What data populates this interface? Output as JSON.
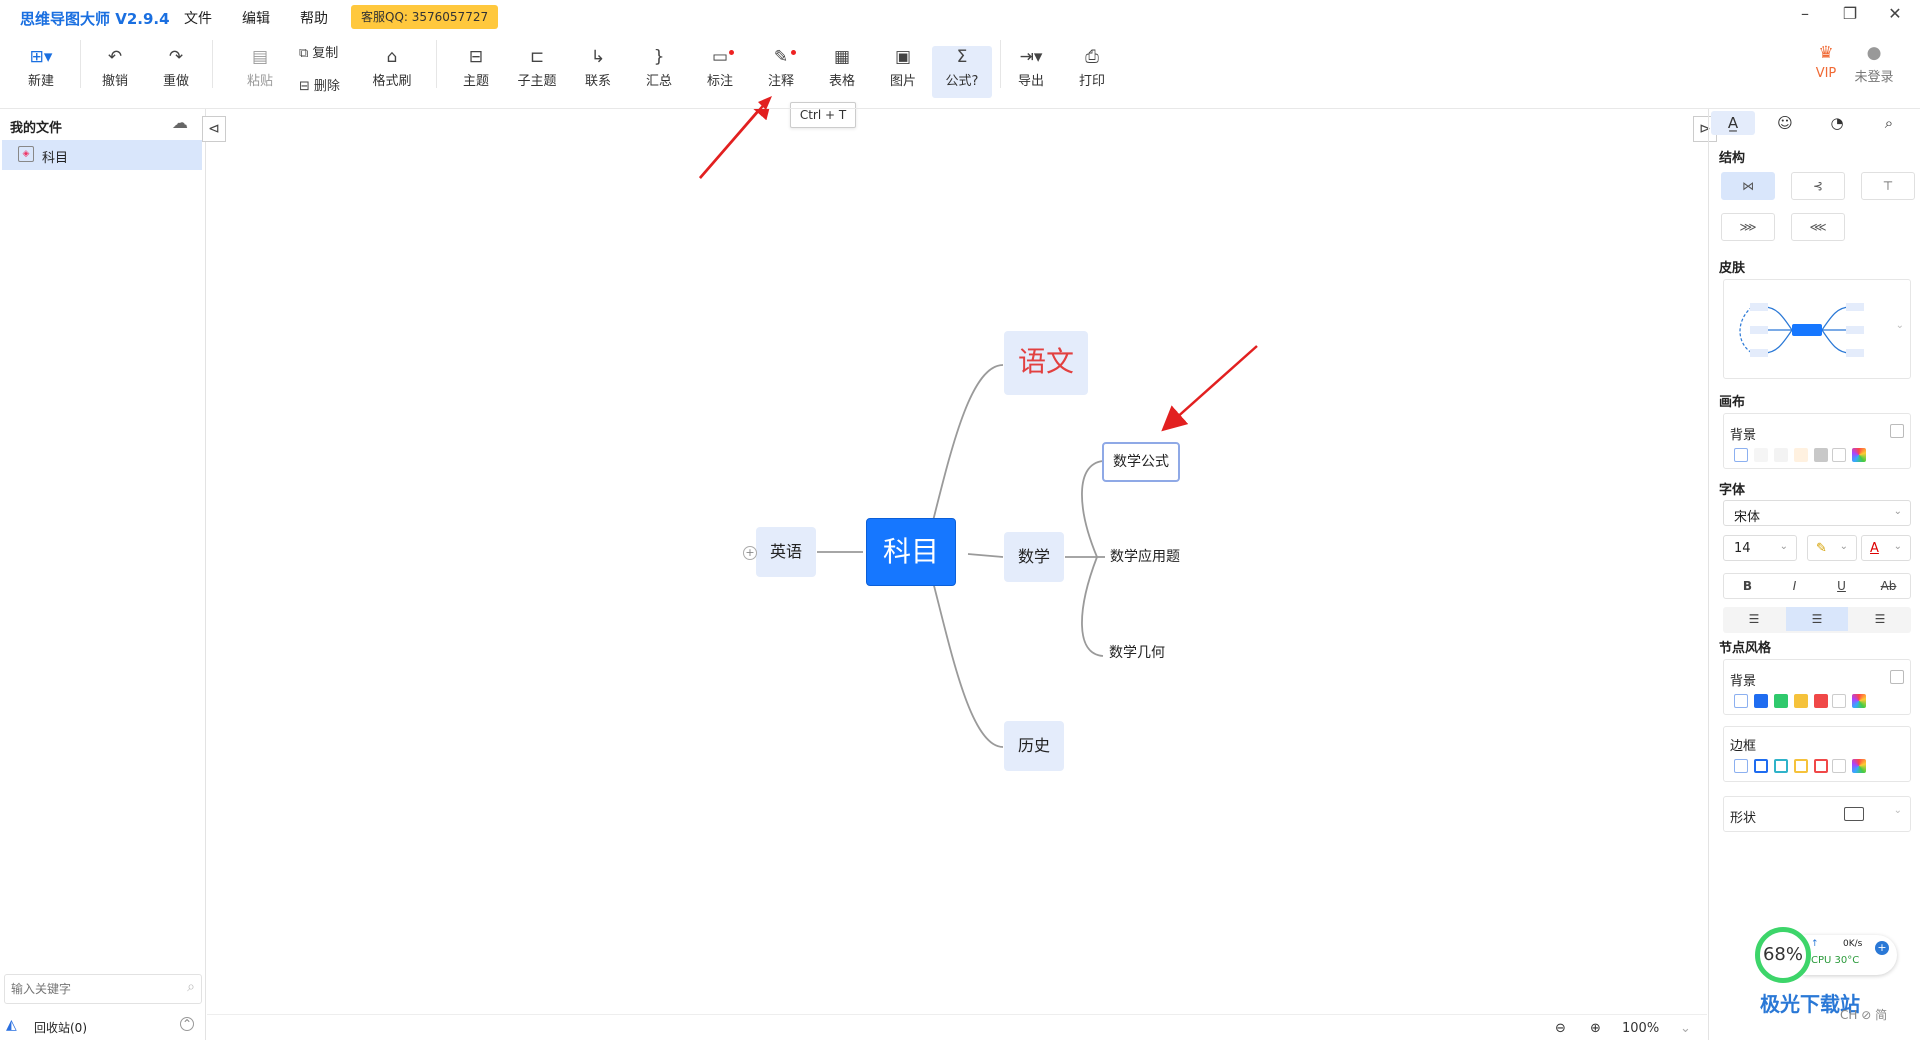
{
  "app": {
    "title": "思维导图大师 V2.9.4",
    "menu": [
      "文件",
      "编辑",
      "帮助"
    ],
    "support_badge": "客服QQ: 3576057727",
    "window_controls": [
      "minimize-icon",
      "restore-icon",
      "close-icon"
    ]
  },
  "toolbar": {
    "new": "新建",
    "undo": "撤销",
    "redo": "重做",
    "paste": "粘贴",
    "copy": "复制",
    "delete": "删除",
    "format_brush": "格式刷",
    "topic": "主题",
    "subtopic": "子主题",
    "relation": "联系",
    "summary": "汇总",
    "marker": "标注",
    "note": "注释",
    "table": "表格",
    "image": "图片",
    "formula": "公式",
    "export": "导出",
    "print": "打印",
    "vip": "VIP",
    "login": "未登录",
    "tooltip": "Ctrl + T"
  },
  "sidebar": {
    "title": "我的文件",
    "files": [
      {
        "name": "科目"
      }
    ],
    "search_placeholder": "输入关键字",
    "trash": "回收站(0)"
  },
  "mindmap": {
    "root": "科目",
    "branches": [
      {
        "label": "语文"
      },
      {
        "label": "英语"
      },
      {
        "label": "数学",
        "children": [
          "数学公式",
          "数学应用题",
          "数学几何"
        ]
      },
      {
        "label": "历史"
      }
    ],
    "selected": "数学公式"
  },
  "status": {
    "zoom": "100%"
  },
  "rightpanel": {
    "tabs": [
      "style-icon",
      "emoji-icon",
      "theme-icon",
      "search-icon"
    ],
    "structure_title": "结构",
    "skin_title": "皮肤",
    "canvas_title": "画布",
    "canvas_background": "背景",
    "font_title": "字体",
    "font_family": "宋体",
    "font_size": "14",
    "format_buttons": [
      "B",
      "I",
      "U",
      "Ab"
    ],
    "node_style_title": "节点风格",
    "node_background": "背景",
    "border_label": "边框",
    "shape_label": "形状",
    "node_colors": [
      "#1f6cf0",
      "#2fc96c",
      "#f5c23b",
      "#f04848"
    ],
    "border_colors": [
      "#1f6cf0",
      "#2fb3c9",
      "#f5c23b",
      "#f04848"
    ],
    "canvas_colors": [
      "#f5f5f5",
      "#f3f3f3",
      "#fff1e0",
      "#c8c8c8"
    ]
  },
  "overlay": {
    "cpu_percent": "68%",
    "speed": "0K/s",
    "cpu_temp": "CPU 30°C",
    "watermark": "极光下载站",
    "ime": "CH ⊘ 简"
  },
  "colors": {
    "accent": "#1677ff",
    "node_bg": "#e4ecfb",
    "arrow": "#e22020"
  }
}
